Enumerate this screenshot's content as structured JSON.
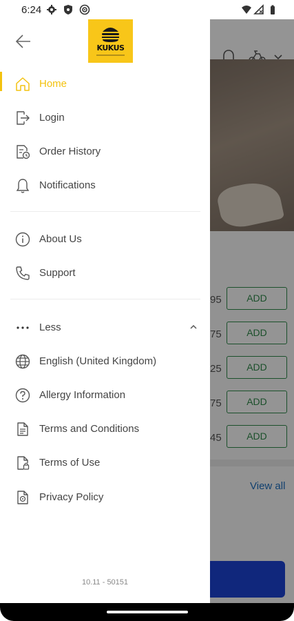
{
  "status_bar": {
    "time": "6:24",
    "icons": [
      "gear-icon",
      "shield-icon",
      "target-icon",
      "wifi-icon",
      "signal-icon",
      "battery-icon"
    ]
  },
  "drawer": {
    "logo_text": "KUKUS",
    "primary_items": [
      {
        "label": "Home",
        "icon": "home-icon",
        "active": true
      },
      {
        "label": "Login",
        "icon": "login-icon"
      },
      {
        "label": "Order History",
        "icon": "order-history-icon"
      },
      {
        "label": "Notifications",
        "icon": "bell-icon"
      }
    ],
    "secondary_items": [
      {
        "label": "About Us",
        "icon": "info-icon"
      },
      {
        "label": "Support",
        "icon": "phone-icon"
      }
    ],
    "more_toggle": {
      "label": "Less",
      "icon": "more-dots-icon"
    },
    "more_items": [
      {
        "label": "English (United Kingdom)",
        "icon": "globe-icon"
      },
      {
        "label": "Allergy Information",
        "icon": "question-icon"
      },
      {
        "label": "Terms and Conditions",
        "icon": "document-icon"
      },
      {
        "label": "Terms of Use",
        "icon": "document-lock-icon"
      },
      {
        "label": "Privacy Policy",
        "icon": "privacy-icon"
      }
    ],
    "version": "10.11 - 50151"
  },
  "background": {
    "prices": [
      "95",
      "75",
      "25",
      "75",
      "45"
    ],
    "add_label": "ADD",
    "view_all": "View all"
  },
  "colors": {
    "accent": "#f3c20f",
    "logo_bg": "#f8c619",
    "add_green": "#2f8a4a",
    "link_blue": "#1e6fbf",
    "cta_blue": "#1d44d6"
  }
}
